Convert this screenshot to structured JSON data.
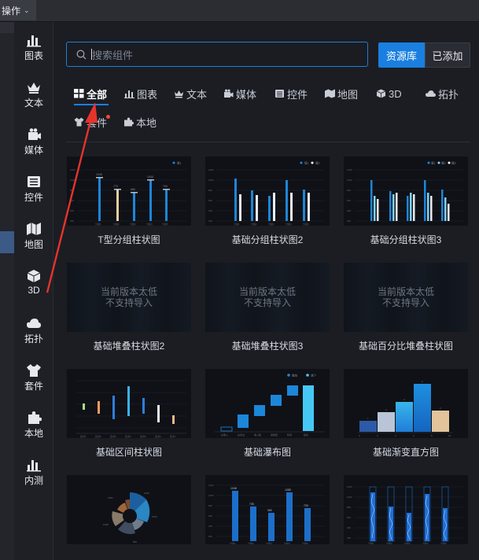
{
  "topbar": {
    "menu_label": "操作"
  },
  "categories": [
    {
      "label": "图表",
      "icon": "chart-icon"
    },
    {
      "label": "文本",
      "icon": "crown-text-icon"
    },
    {
      "label": "媒体",
      "icon": "media-icon"
    },
    {
      "label": "控件",
      "icon": "widget-icon"
    },
    {
      "label": "地图",
      "icon": "map-icon"
    },
    {
      "label": "3D",
      "icon": "cube-icon"
    },
    {
      "label": "拓扑",
      "icon": "topology-icon"
    },
    {
      "label": "套件",
      "icon": "shirt-icon"
    },
    {
      "label": "本地",
      "icon": "puzzle-icon"
    },
    {
      "label": "内测",
      "icon": "beta-chart-icon"
    }
  ],
  "search": {
    "placeholder": "搜索组件"
  },
  "buttons": {
    "library": "资源库",
    "added": "已添加"
  },
  "tabs": [
    {
      "label": "全部",
      "icon": "grid-icon",
      "active": true
    },
    {
      "label": "图表",
      "icon": "chart-icon"
    },
    {
      "label": "文本",
      "icon": "crown-text-icon"
    },
    {
      "label": "媒体",
      "icon": "media-icon"
    },
    {
      "label": "控件",
      "icon": "widget-icon"
    },
    {
      "label": "地图",
      "icon": "map-icon"
    },
    {
      "label": "3D",
      "icon": "cube-icon"
    },
    {
      "label": "拓扑",
      "icon": "topology-icon"
    },
    {
      "label": "套件",
      "icon": "shirt-icon"
    },
    {
      "label": "本地",
      "icon": "puzzle-icon"
    }
  ],
  "unsupported_text": {
    "line1": "当前版本太低",
    "line2": "不支持导入"
  },
  "components": [
    {
      "label": "T型分组柱状图",
      "thumb": "t-group-bar"
    },
    {
      "label": "基础分组柱状图2",
      "thumb": "group-bar-2"
    },
    {
      "label": "基础分组柱状图3",
      "thumb": "group-bar-3"
    },
    {
      "label": "基础堆叠柱状图2",
      "thumb": "unsupported"
    },
    {
      "label": "基础堆叠柱状图3",
      "thumb": "unsupported"
    },
    {
      "label": "基础百分比堆叠柱状图",
      "thumb": "unsupported"
    },
    {
      "label": "基础区间柱状图",
      "thumb": "range-bar"
    },
    {
      "label": "基础瀑布图",
      "thumb": "waterfall"
    },
    {
      "label": "基础渐变直方图",
      "thumb": "gradient-histogram"
    },
    {
      "label": "",
      "thumb": "rose"
    },
    {
      "label": "",
      "thumb": "bar-labels"
    },
    {
      "label": "",
      "thumb": "bar-lights"
    }
  ],
  "colors": {
    "accent": "#1a7fe0",
    "annotation_arrow": "#e8332b",
    "notification_dot": "#f04a3a"
  }
}
